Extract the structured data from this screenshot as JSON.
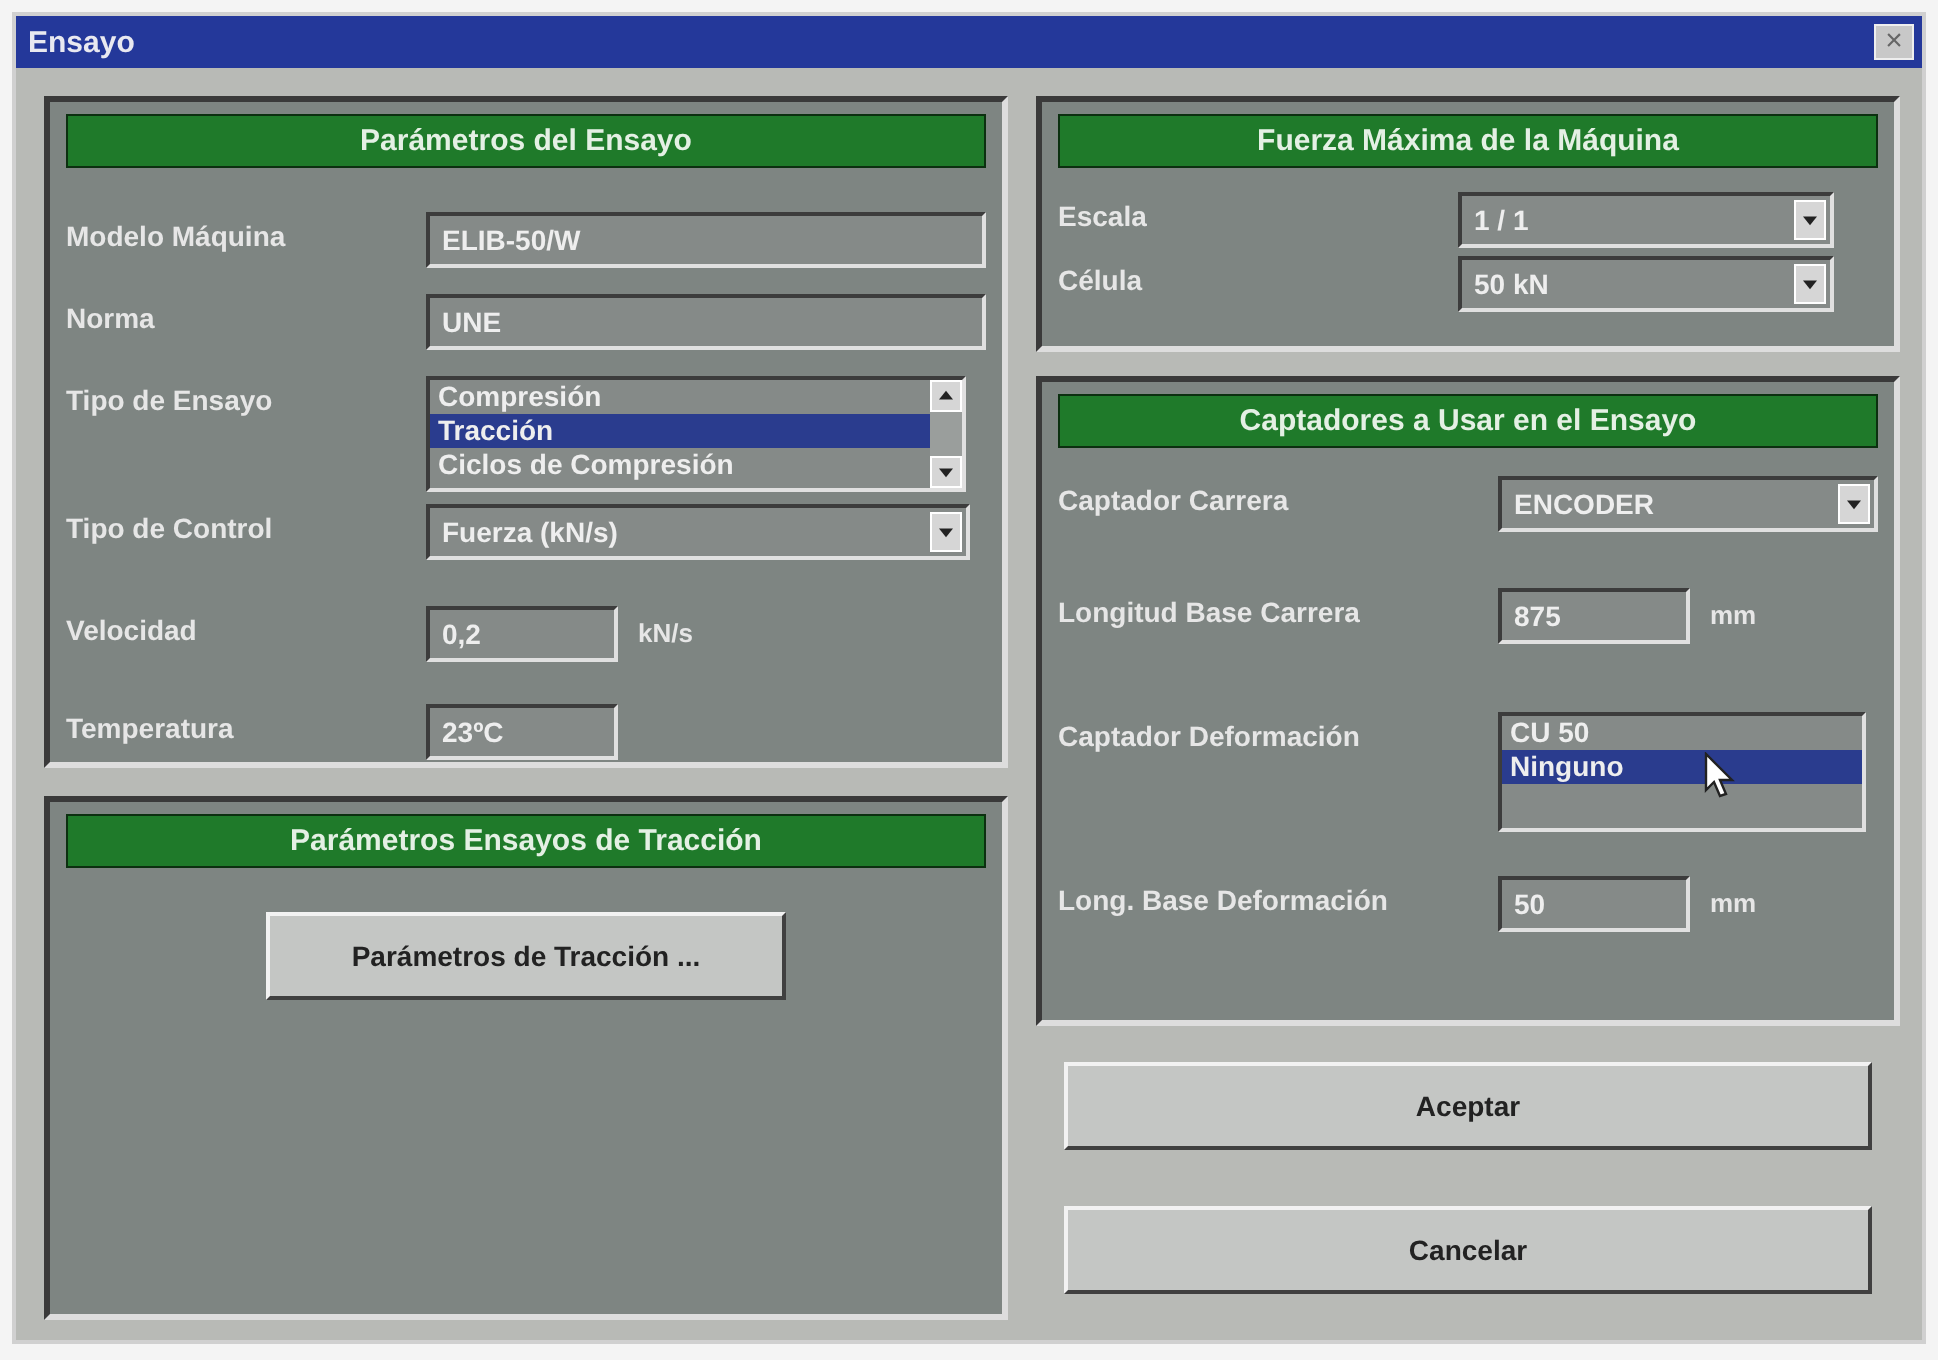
{
  "window": {
    "title": "Ensayo",
    "close": "×"
  },
  "test_parameters": {
    "title": "Parámetros del Ensayo",
    "fields": [
      {
        "kind": "text",
        "label": "Modelo Máquina",
        "value": "ELIB-50/W"
      },
      {
        "kind": "text",
        "label": "Norma",
        "value": "UNE"
      },
      {
        "kind": "listbox",
        "label": "Tipo de Ensayo",
        "options": [
          {
            "label": "Compresión",
            "selected": false
          },
          {
            "label": "Tracción",
            "selected": true
          },
          {
            "label": "Ciclos de Compresión",
            "selected": false
          }
        ]
      },
      {
        "kind": "dropdown",
        "label": "Tipo de Control",
        "value": "Fuerza (kN/s)"
      },
      {
        "kind": "text",
        "label": "Velocidad",
        "value": "0,2",
        "unit": "kN/s"
      },
      {
        "kind": "text",
        "label": "Temperatura",
        "value": "23ºC"
      }
    ]
  },
  "max_force": {
    "title": "Fuerza Máxima de la Máquina",
    "fields": [
      {
        "kind": "dropdown",
        "label": "Escala",
        "value": "1 / 1"
      },
      {
        "kind": "dropdown",
        "label": "Célula",
        "value": "50 kN"
      }
    ]
  },
  "sensors": {
    "title": "Captadores a Usar en el Ensayo",
    "fields": [
      {
        "kind": "dropdown",
        "label": "Captador Carrera",
        "value": "ENCODER"
      },
      {
        "kind": "text",
        "label": "Longitud Base Carrera",
        "value": "875",
        "unit": "mm"
      },
      {
        "kind": "listbox",
        "label": "Captador Deformación",
        "options": [
          {
            "label": "CU 50",
            "selected": false
          },
          {
            "label": "Ninguno",
            "selected": true
          }
        ]
      },
      {
        "kind": "text",
        "label": "Long. Base Deformación",
        "value": "50",
        "unit": "mm"
      }
    ]
  },
  "tensile_parameters": {
    "title": "Parámetros Ensayos de Tracción",
    "button": "Parámetros de Tracción ..."
  },
  "buttons": [
    "Aceptar",
    "Cancelar"
  ]
}
